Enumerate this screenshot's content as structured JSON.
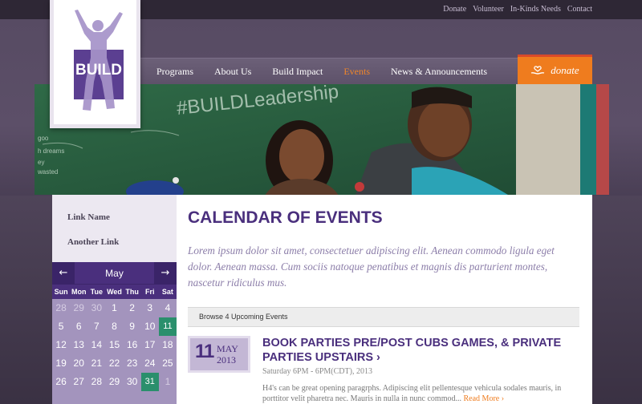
{
  "utility_nav": [
    "Donate",
    "Volunteer",
    "In-Kinds Needs",
    "Contact"
  ],
  "logo": {
    "text": "BUILD"
  },
  "main_nav": [
    {
      "label": "Programs",
      "active": false
    },
    {
      "label": "About Us",
      "active": false
    },
    {
      "label": "Build Impact",
      "active": false
    },
    {
      "label": "Events",
      "active": true
    },
    {
      "label": "News & Announcements",
      "active": false
    }
  ],
  "donate": {
    "label": "donate",
    "icon": "hand-heart-icon"
  },
  "hero": {
    "chalkboard_text": [
      "#BUILDLeadership",
      "goo",
      "h dreams",
      "ey",
      "wasted"
    ]
  },
  "sidebar": {
    "links": [
      "Link Name",
      "Another Link"
    ],
    "calendar": {
      "month": "May",
      "prev_icon": "arrow-left-icon",
      "next_icon": "arrow-right-icon",
      "weekdays": [
        "Sun",
        "Mon",
        "Tue",
        "Wed",
        "Thu",
        "Fri",
        "Sat"
      ],
      "weeks": [
        [
          "28",
          "29",
          "30",
          "1",
          "2",
          "3",
          "4"
        ],
        [
          "5",
          "6",
          "7",
          "8",
          "9",
          "10",
          "11"
        ],
        [
          "12",
          "13",
          "14",
          "15",
          "16",
          "17",
          "18"
        ],
        [
          "19",
          "20",
          "21",
          "22",
          "23",
          "24",
          "25"
        ],
        [
          "26",
          "27",
          "28",
          "29",
          "30",
          "31",
          "1"
        ]
      ],
      "highlighted": [
        "11",
        "31"
      ]
    }
  },
  "main": {
    "title": "CALENDAR OF EVENTS",
    "intro": "Lorem ipsum dolor sit amet, consectetuer adipiscing elit. Aenean commodo ligula eget dolor. Aenean massa. Cum sociis natoque penatibus et magnis dis parturient montes, nascetur ridiculus mus.",
    "upcoming_label": "Browse 4 Upcoming Events",
    "event": {
      "day": "11",
      "month": "MAY",
      "year": "2013",
      "title": "BOOK PARTIES PRE/POST CUBS GAMES, & PRIVATE PARTIES UPSTAIRS ›",
      "time": "Saturday 6PM - 6PM(CDT), 2013",
      "description": "H4's can be great opening paragrphs. Adipiscing elit pellentesque vehicula sodales mauris, in porttitor velit pharetra nec. Mauris in nulla in nunc commod...",
      "read_more": "Read More ›"
    }
  },
  "colors": {
    "brand_purple": "#4a2f7d",
    "accent_orange": "#ef7c1e",
    "highlight_green": "#2a8f6c",
    "intro_text": "#8c7ea9"
  }
}
